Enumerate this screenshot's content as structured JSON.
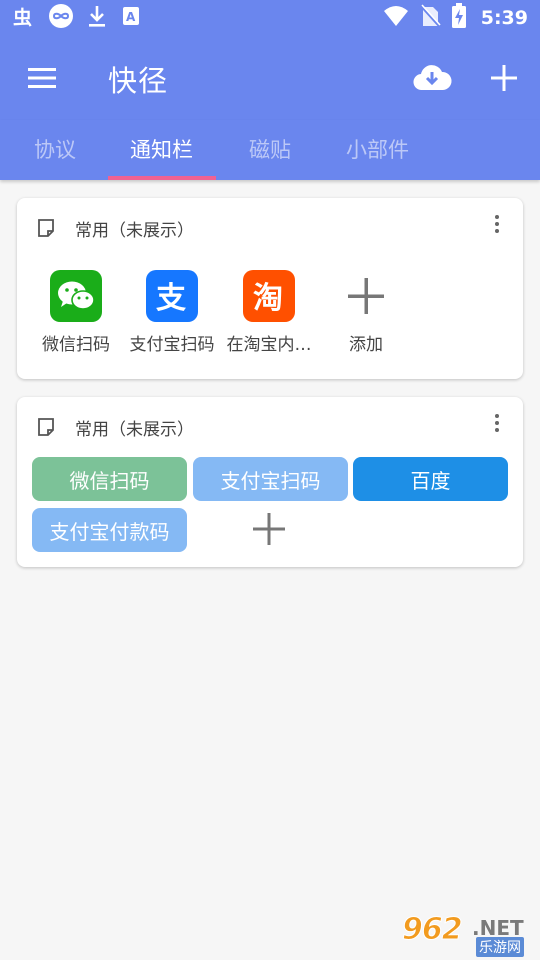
{
  "status_bar": {
    "time": "5:39",
    "left_icons": [
      "bug-notification-icon",
      "infinity-notification-icon",
      "download-icon",
      "app-notification-icon"
    ],
    "right_icons": [
      "wifi-icon",
      "no-sim-icon",
      "battery-icon"
    ]
  },
  "app_bar": {
    "title": "快径",
    "left_icon": "menu-icon",
    "right_icons": [
      "cloud-download-icon",
      "add-icon"
    ]
  },
  "tabs": [
    {
      "label": "协议",
      "active": false
    },
    {
      "label": "通知栏",
      "active": true
    },
    {
      "label": "磁贴",
      "active": false
    },
    {
      "label": "小部件",
      "active": false
    }
  ],
  "cards": [
    {
      "title": "常用（未展示）",
      "shortcuts": [
        {
          "label": "微信扫码",
          "icon": "wechat-icon"
        },
        {
          "label": "支付宝扫码",
          "icon": "alipay-icon"
        },
        {
          "label": "在淘宝内…",
          "icon": "taobao-icon"
        },
        {
          "label": "添加",
          "icon": "add-icon"
        }
      ]
    },
    {
      "title": "常用（未展示）",
      "chips": [
        {
          "label": "微信扫码",
          "color": "#7cc298"
        },
        {
          "label": "支付宝扫码",
          "color": "#85b9f4"
        },
        {
          "label": "百度",
          "color": "#1e8fe6"
        },
        {
          "label": "支付宝付款码",
          "color": "#85b9f4"
        }
      ]
    }
  ],
  "colors": {
    "primary": "#6a86ee",
    "tab_indicator": "#f06292",
    "background": "#f6f6f6",
    "wechat": "#1aad19",
    "alipay": "#1677ff",
    "taobao": "#ff5000"
  },
  "watermark": {
    "number": "962",
    "domain": ".NET",
    "subtitle": "乐游网"
  }
}
